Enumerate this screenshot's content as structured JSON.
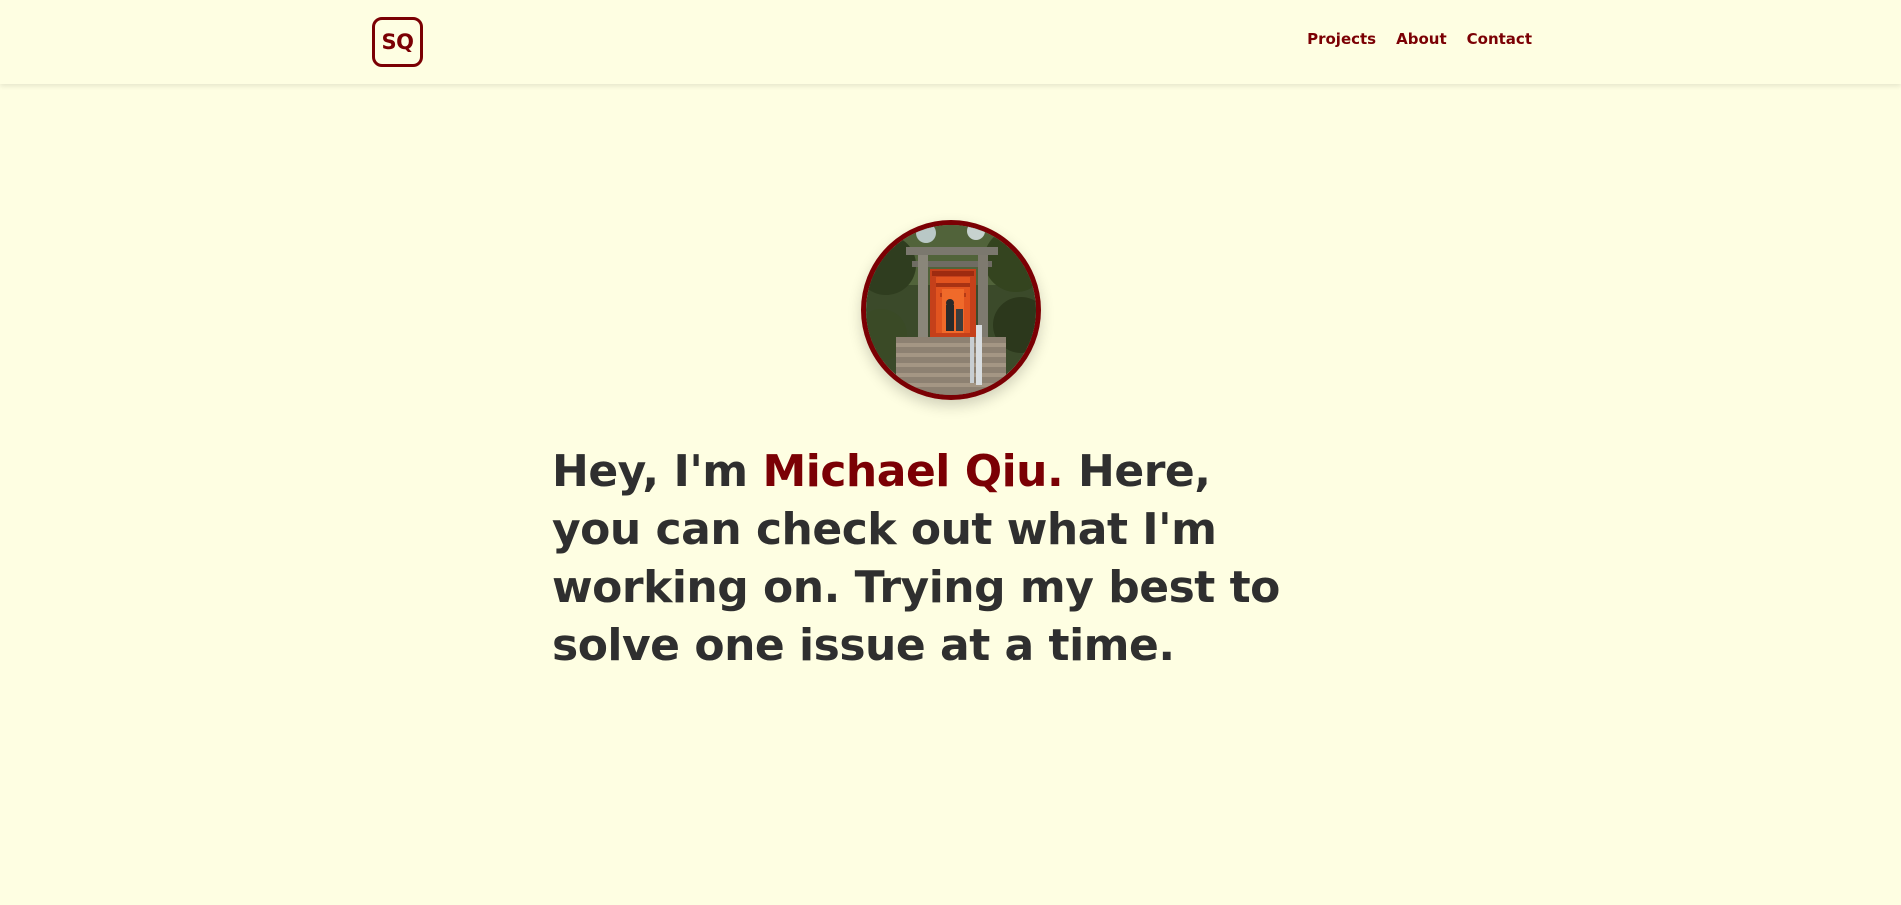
{
  "nav": {
    "logo_text": "SQ",
    "links": [
      "Projects",
      "About",
      "Contact"
    ]
  },
  "hero": {
    "avatar_alt": "Torii gates path",
    "intro": "Hey, I'm",
    "name": "Michael Qiu.",
    "rest": "Here, you can check out what I'm working on. Trying my best to solve one issue at a time."
  },
  "colors": {
    "background": "#fefee2",
    "accent": "#7b0004",
    "text": "#2f2f2f"
  }
}
